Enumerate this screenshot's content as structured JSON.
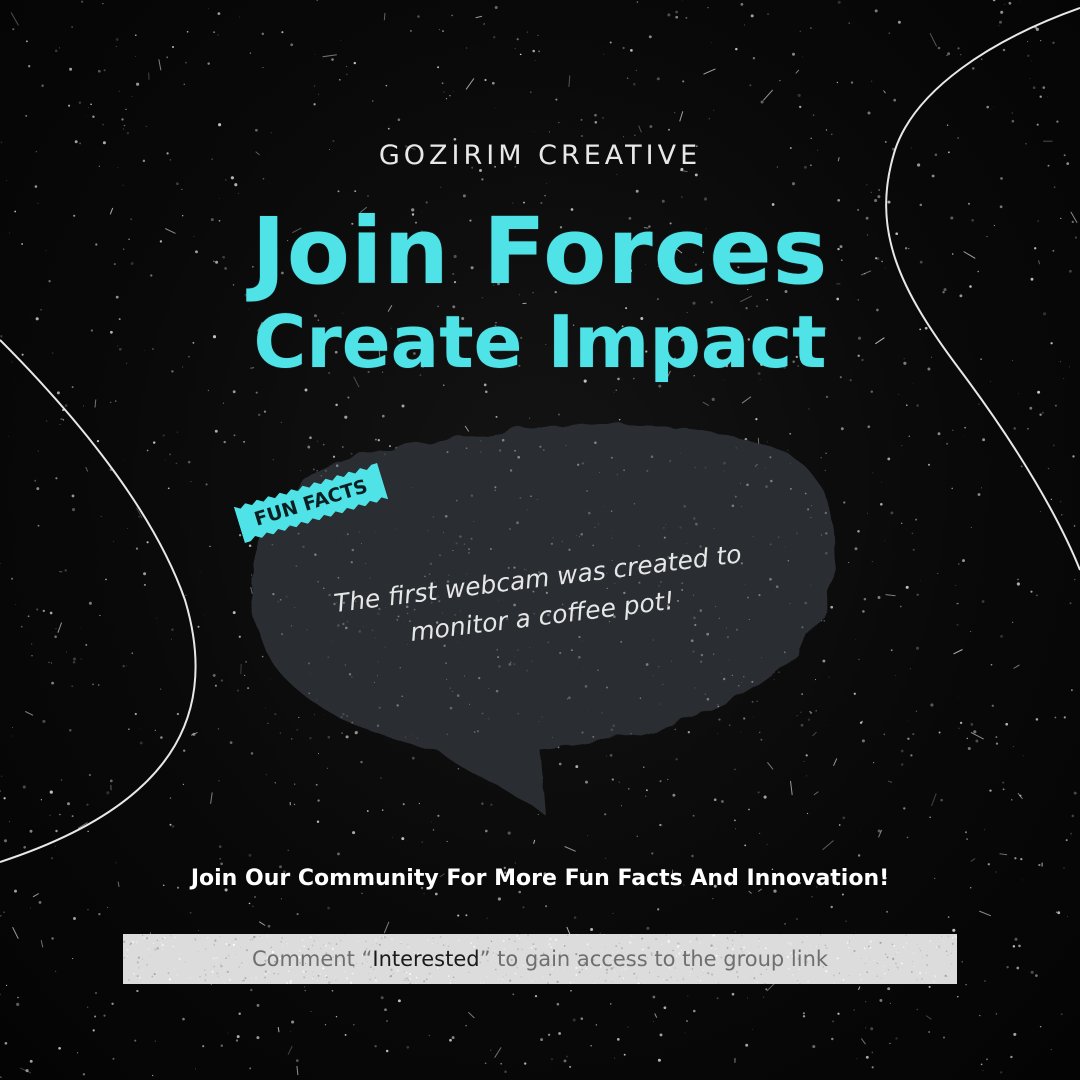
{
  "brand": "GOZIRIM CREATIVE",
  "headline": {
    "line1": "Join Forces",
    "line2": "Create Impact"
  },
  "tag": "FUN FACTS",
  "fact": {
    "line1": "The first webcam was created to",
    "line2": "monitor a coffee pot!"
  },
  "cta": "Join Our Community For More Fun Facts And Innovation!",
  "bar": {
    "prefix": "Comment “",
    "keyword": "Interested",
    "suffix": "” to gain access to the group link"
  },
  "colors": {
    "accent": "#4fe3e8",
    "background": "#000000",
    "bubble": "#2a2f33",
    "bar": "#dcdcdc"
  }
}
